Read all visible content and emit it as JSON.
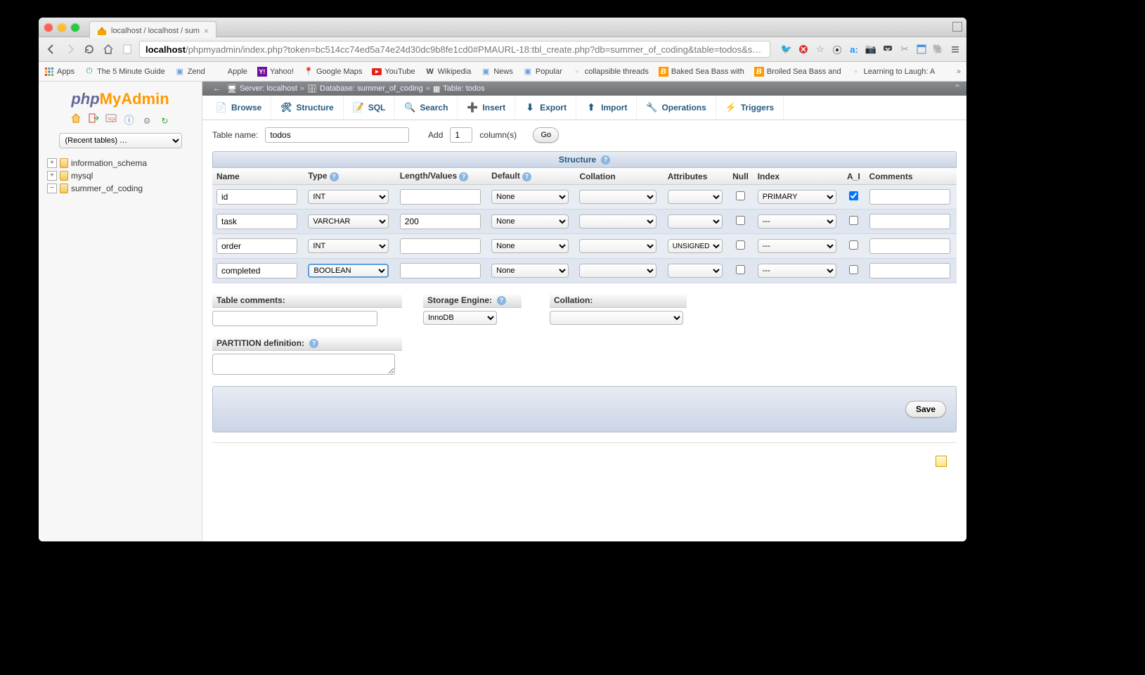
{
  "browser": {
    "tab_title": "localhost / localhost / sum",
    "url_host": "localhost",
    "url_path": "/phpmyadmin/index.php?token=bc514cc74ed5a74e24d30dc9b8fe1cd0#PMAURL-18:tbl_create.php?db=summer_of_coding&table=todos&s…"
  },
  "bookmarks": {
    "apps_label": "Apps",
    "items": [
      "The 5 Minute Guide",
      "Zend",
      "Apple",
      "Yahoo!",
      "Google Maps",
      "YouTube",
      "Wikipedia",
      "News",
      "Popular",
      "collapsible threads",
      "Baked Sea Bass with",
      "Broiled Sea Bass and",
      "Learning to Laugh: A"
    ]
  },
  "sidebar": {
    "recent_tables": "(Recent tables) …",
    "dbs": [
      {
        "toggle": "+",
        "name": "information_schema"
      },
      {
        "toggle": "+",
        "name": "mysql"
      },
      {
        "toggle": "−",
        "name": "summer_of_coding"
      }
    ]
  },
  "breadcrumb": {
    "arrow": "←",
    "server_label": "Server: localhost",
    "db_label": "Database: summer_of_coding",
    "table_label": "Table: todos",
    "sep": "»"
  },
  "tabs": {
    "browse": "Browse",
    "structure": "Structure",
    "sql": "SQL",
    "search": "Search",
    "insert": "Insert",
    "export": "Export",
    "import": "Import",
    "operations": "Operations",
    "triggers": "Triggers"
  },
  "form": {
    "table_name_label": "Table name:",
    "table_name_value": "todos",
    "add_label": "Add",
    "add_count": "1",
    "columns_label": "column(s)",
    "go_label": "Go",
    "structure_title": "Structure",
    "headers": {
      "name": "Name",
      "type": "Type",
      "length": "Length/Values",
      "default": "Default",
      "collation": "Collation",
      "attributes": "Attributes",
      "null": "Null",
      "index": "Index",
      "ai": "A_I",
      "comments": "Comments"
    },
    "rows": [
      {
        "name": "id",
        "type": "INT",
        "length": "",
        "default": "None",
        "collation": "",
        "attributes": "",
        "null": false,
        "index": "PRIMARY",
        "ai": true,
        "comments": ""
      },
      {
        "name": "task",
        "type": "VARCHAR",
        "length": "200",
        "default": "None",
        "collation": "",
        "attributes": "",
        "null": false,
        "index": "---",
        "ai": false,
        "comments": ""
      },
      {
        "name": "order",
        "type": "INT",
        "length": "",
        "default": "None",
        "collation": "",
        "attributes": "UNSIGNED",
        "null": false,
        "index": "---",
        "ai": false,
        "comments": ""
      },
      {
        "name": "completed",
        "type": "BOOLEAN",
        "length": "",
        "default": "None",
        "collation": "",
        "attributes": "",
        "null": false,
        "index": "---",
        "ai": false,
        "comments": "",
        "type_focused": true
      }
    ],
    "table_comments_label": "Table comments:",
    "table_comments_value": "",
    "storage_engine_label": "Storage Engine:",
    "storage_engine_value": "InnoDB",
    "collation_label": "Collation:",
    "collation_value": "",
    "partition_label": "PARTITION definition:",
    "partition_value": "",
    "save_label": "Save"
  }
}
